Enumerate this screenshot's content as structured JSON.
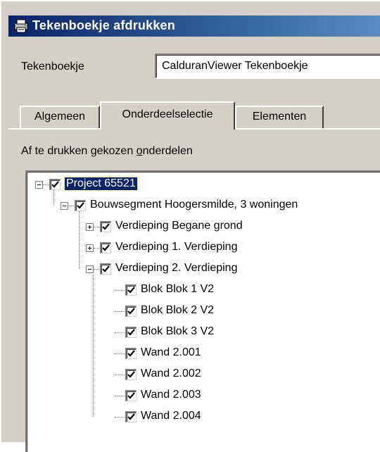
{
  "window": {
    "title": "Tekenboekje afdrukken",
    "title_icon": "printer-app-icon"
  },
  "form": {
    "tekenboekje_label": "Tekenboekje",
    "tekenboekje_value": "CalduranViewer Tekenboekje"
  },
  "tabs": [
    {
      "label": "Algemeen",
      "active": false
    },
    {
      "label": "Onderdeelselectie",
      "active": true
    },
    {
      "label": "Elementen",
      "active": false
    }
  ],
  "selection": {
    "label_prefix": "Af te drukken ",
    "label_g": "g",
    "label_mid": "ekozen ",
    "label_o": "o",
    "label_suffix": "nderdelen"
  },
  "tree": {
    "items": [
      {
        "label": "Project 65521",
        "checked": true,
        "expanded": true,
        "selected": true
      },
      {
        "label": "Bouwsegment Hoogersmilde, 3 woningen",
        "checked": true,
        "expanded": true
      },
      {
        "label": "Verdieping Begane grond",
        "checked": true,
        "expanded": false
      },
      {
        "label": "Verdieping 1. Verdieping",
        "checked": true,
        "expanded": false
      },
      {
        "label": "Verdieping 2. Verdieping",
        "checked": true,
        "expanded": true
      },
      {
        "label": "Blok Blok 1 V2",
        "checked": true
      },
      {
        "label": "Blok Blok 2 V2",
        "checked": true
      },
      {
        "label": "Blok Blok 3 V2",
        "checked": true
      },
      {
        "label": "Wand 2.001",
        "checked": true
      },
      {
        "label": "Wand 2.002",
        "checked": true
      },
      {
        "label": "Wand 2.003",
        "checked": true
      },
      {
        "label": "Wand 2.004",
        "checked": true
      }
    ]
  },
  "colors": {
    "titlebar": "#0a246a",
    "face": "#d4d0c8",
    "selection": "#0a246a"
  }
}
